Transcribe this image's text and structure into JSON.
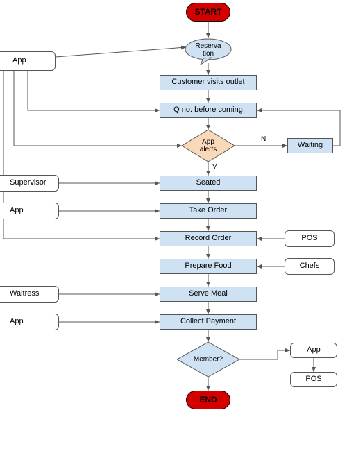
{
  "chart_data": {
    "type": "flowchart",
    "title": "",
    "nodes": [
      {
        "id": "start",
        "type": "terminator",
        "label": "START"
      },
      {
        "id": "reservation",
        "type": "callout",
        "label": "Reserva\ntion"
      },
      {
        "id": "visits",
        "type": "process",
        "label": "Customer visits outlet"
      },
      {
        "id": "qno",
        "type": "process",
        "label": "Q no. before coming"
      },
      {
        "id": "alerts",
        "type": "decision",
        "label": "App\nalerts"
      },
      {
        "id": "waiting",
        "type": "process",
        "label": "Waiting"
      },
      {
        "id": "seated",
        "type": "process",
        "label": "Seated"
      },
      {
        "id": "takeorder",
        "type": "process",
        "label": "Take Order"
      },
      {
        "id": "recordorder",
        "type": "process",
        "label": "Record Order"
      },
      {
        "id": "preparefood",
        "type": "process",
        "label": "Prepare Food"
      },
      {
        "id": "servemeal",
        "type": "process",
        "label": "Serve Meal"
      },
      {
        "id": "collect",
        "type": "process",
        "label": "Collect Payment"
      },
      {
        "id": "member",
        "type": "decision",
        "label": "Member?"
      },
      {
        "id": "end",
        "type": "terminator",
        "label": "END"
      },
      {
        "id": "actor_app1",
        "type": "actor",
        "label": "App"
      },
      {
        "id": "actor_supervisor",
        "type": "actor",
        "label": "Supervisor"
      },
      {
        "id": "actor_app2",
        "type": "actor",
        "label": "App"
      },
      {
        "id": "actor_waitress",
        "type": "actor",
        "label": "Waitress"
      },
      {
        "id": "actor_app3",
        "type": "actor",
        "label": "App"
      },
      {
        "id": "actor_pos",
        "type": "actor",
        "label": "POS"
      },
      {
        "id": "actor_chefs",
        "type": "actor",
        "label": "Chefs"
      },
      {
        "id": "actor_app4",
        "type": "actor",
        "label": "App"
      },
      {
        "id": "actor_pos2",
        "type": "actor",
        "label": "POS"
      }
    ],
    "edges": [
      {
        "from": "start",
        "to": "reservation"
      },
      {
        "from": "reservation",
        "to": "visits"
      },
      {
        "from": "visits",
        "to": "qno"
      },
      {
        "from": "qno",
        "to": "alerts"
      },
      {
        "from": "alerts",
        "to": "seated",
        "label": "Y"
      },
      {
        "from": "alerts",
        "to": "waiting",
        "label": "N"
      },
      {
        "from": "waiting",
        "to": "qno"
      },
      {
        "from": "seated",
        "to": "takeorder"
      },
      {
        "from": "takeorder",
        "to": "recordorder"
      },
      {
        "from": "recordorder",
        "to": "preparefood"
      },
      {
        "from": "preparefood",
        "to": "servemeal"
      },
      {
        "from": "servemeal",
        "to": "collect"
      },
      {
        "from": "collect",
        "to": "member"
      },
      {
        "from": "member",
        "to": "end"
      },
      {
        "from": "actor_app1",
        "to": "reservation"
      },
      {
        "from": "actor_app1",
        "to": "qno"
      },
      {
        "from": "actor_app1",
        "to": "alerts"
      },
      {
        "from": "actor_app1",
        "to": "recordorder"
      },
      {
        "from": "actor_supervisor",
        "to": "seated"
      },
      {
        "from": "actor_app2",
        "to": "takeorder"
      },
      {
        "from": "actor_waitress",
        "to": "servemeal"
      },
      {
        "from": "actor_app3",
        "to": "collect"
      },
      {
        "from": "actor_pos",
        "to": "recordorder"
      },
      {
        "from": "actor_chefs",
        "to": "preparefood"
      },
      {
        "from": "member",
        "to": "actor_app4"
      },
      {
        "from": "actor_app4",
        "to": "actor_pos2"
      }
    ]
  },
  "labels": {
    "start": "START",
    "end": "END",
    "reservation": "Reserva tion",
    "visits": "Customer visits outlet",
    "qno": "Q no. before coming",
    "alerts": "App alerts",
    "waiting": "Waiting",
    "seated": "Seated",
    "takeorder": "Take Order",
    "recordorder": "Record Order",
    "preparefood": "Prepare Food",
    "servemeal": "Serve Meal",
    "collect": "Collect Payment",
    "member": "Member?",
    "actor_app1": "App",
    "actor_supervisor": "Supervisor",
    "actor_app2": "App",
    "actor_waitress": "Waitress",
    "actor_app3": "App",
    "actor_pos": "POS",
    "actor_chefs": "Chefs",
    "actor_app4": "App",
    "actor_pos2": "POS",
    "yes": "Y",
    "no": "N"
  },
  "colors": {
    "terminator": "#d40000",
    "process": "#cfe2f3",
    "decision": "#f9d9b8",
    "decision2": "#cfe2f3",
    "actor": "#ffffff",
    "stroke": "#555555"
  }
}
